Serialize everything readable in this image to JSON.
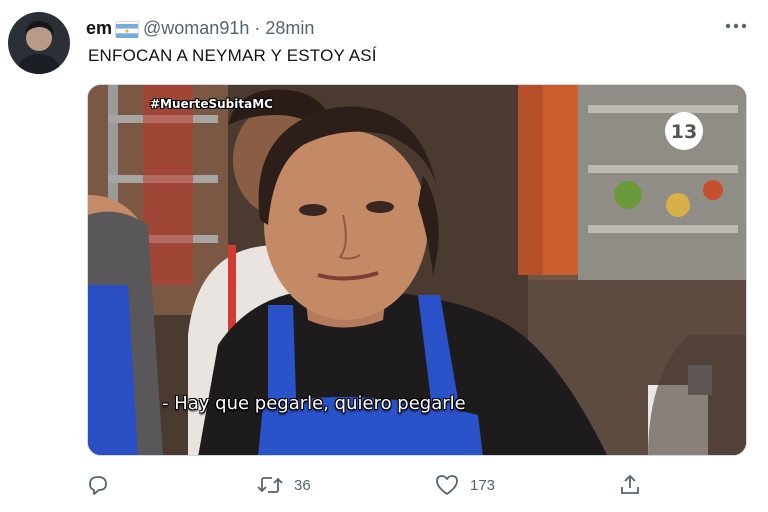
{
  "tweet": {
    "display_name": "em",
    "flag_icon": "argentina-flag-icon",
    "handle": "@woman91h",
    "separator": "·",
    "time": "28min",
    "text": "ENFOCAN A NEYMAR Y ESTOY ASÍ"
  },
  "media": {
    "hashtag": "#MuerteSubitaMC",
    "channel_logo_text": "13",
    "subtitle": "- Hay que pegarle, quiero pegarle"
  },
  "actions": {
    "reply": {
      "icon": "reply-icon",
      "count": ""
    },
    "retweet": {
      "icon": "retweet-icon",
      "count": "36"
    },
    "like": {
      "icon": "heart-icon",
      "count": "173"
    },
    "share": {
      "icon": "share-icon",
      "count": ""
    }
  },
  "colors": {
    "text": "#0f1419",
    "secondary": "#536471",
    "flag_blue": "#74acdf",
    "apron_blue": "#2a52c9"
  }
}
